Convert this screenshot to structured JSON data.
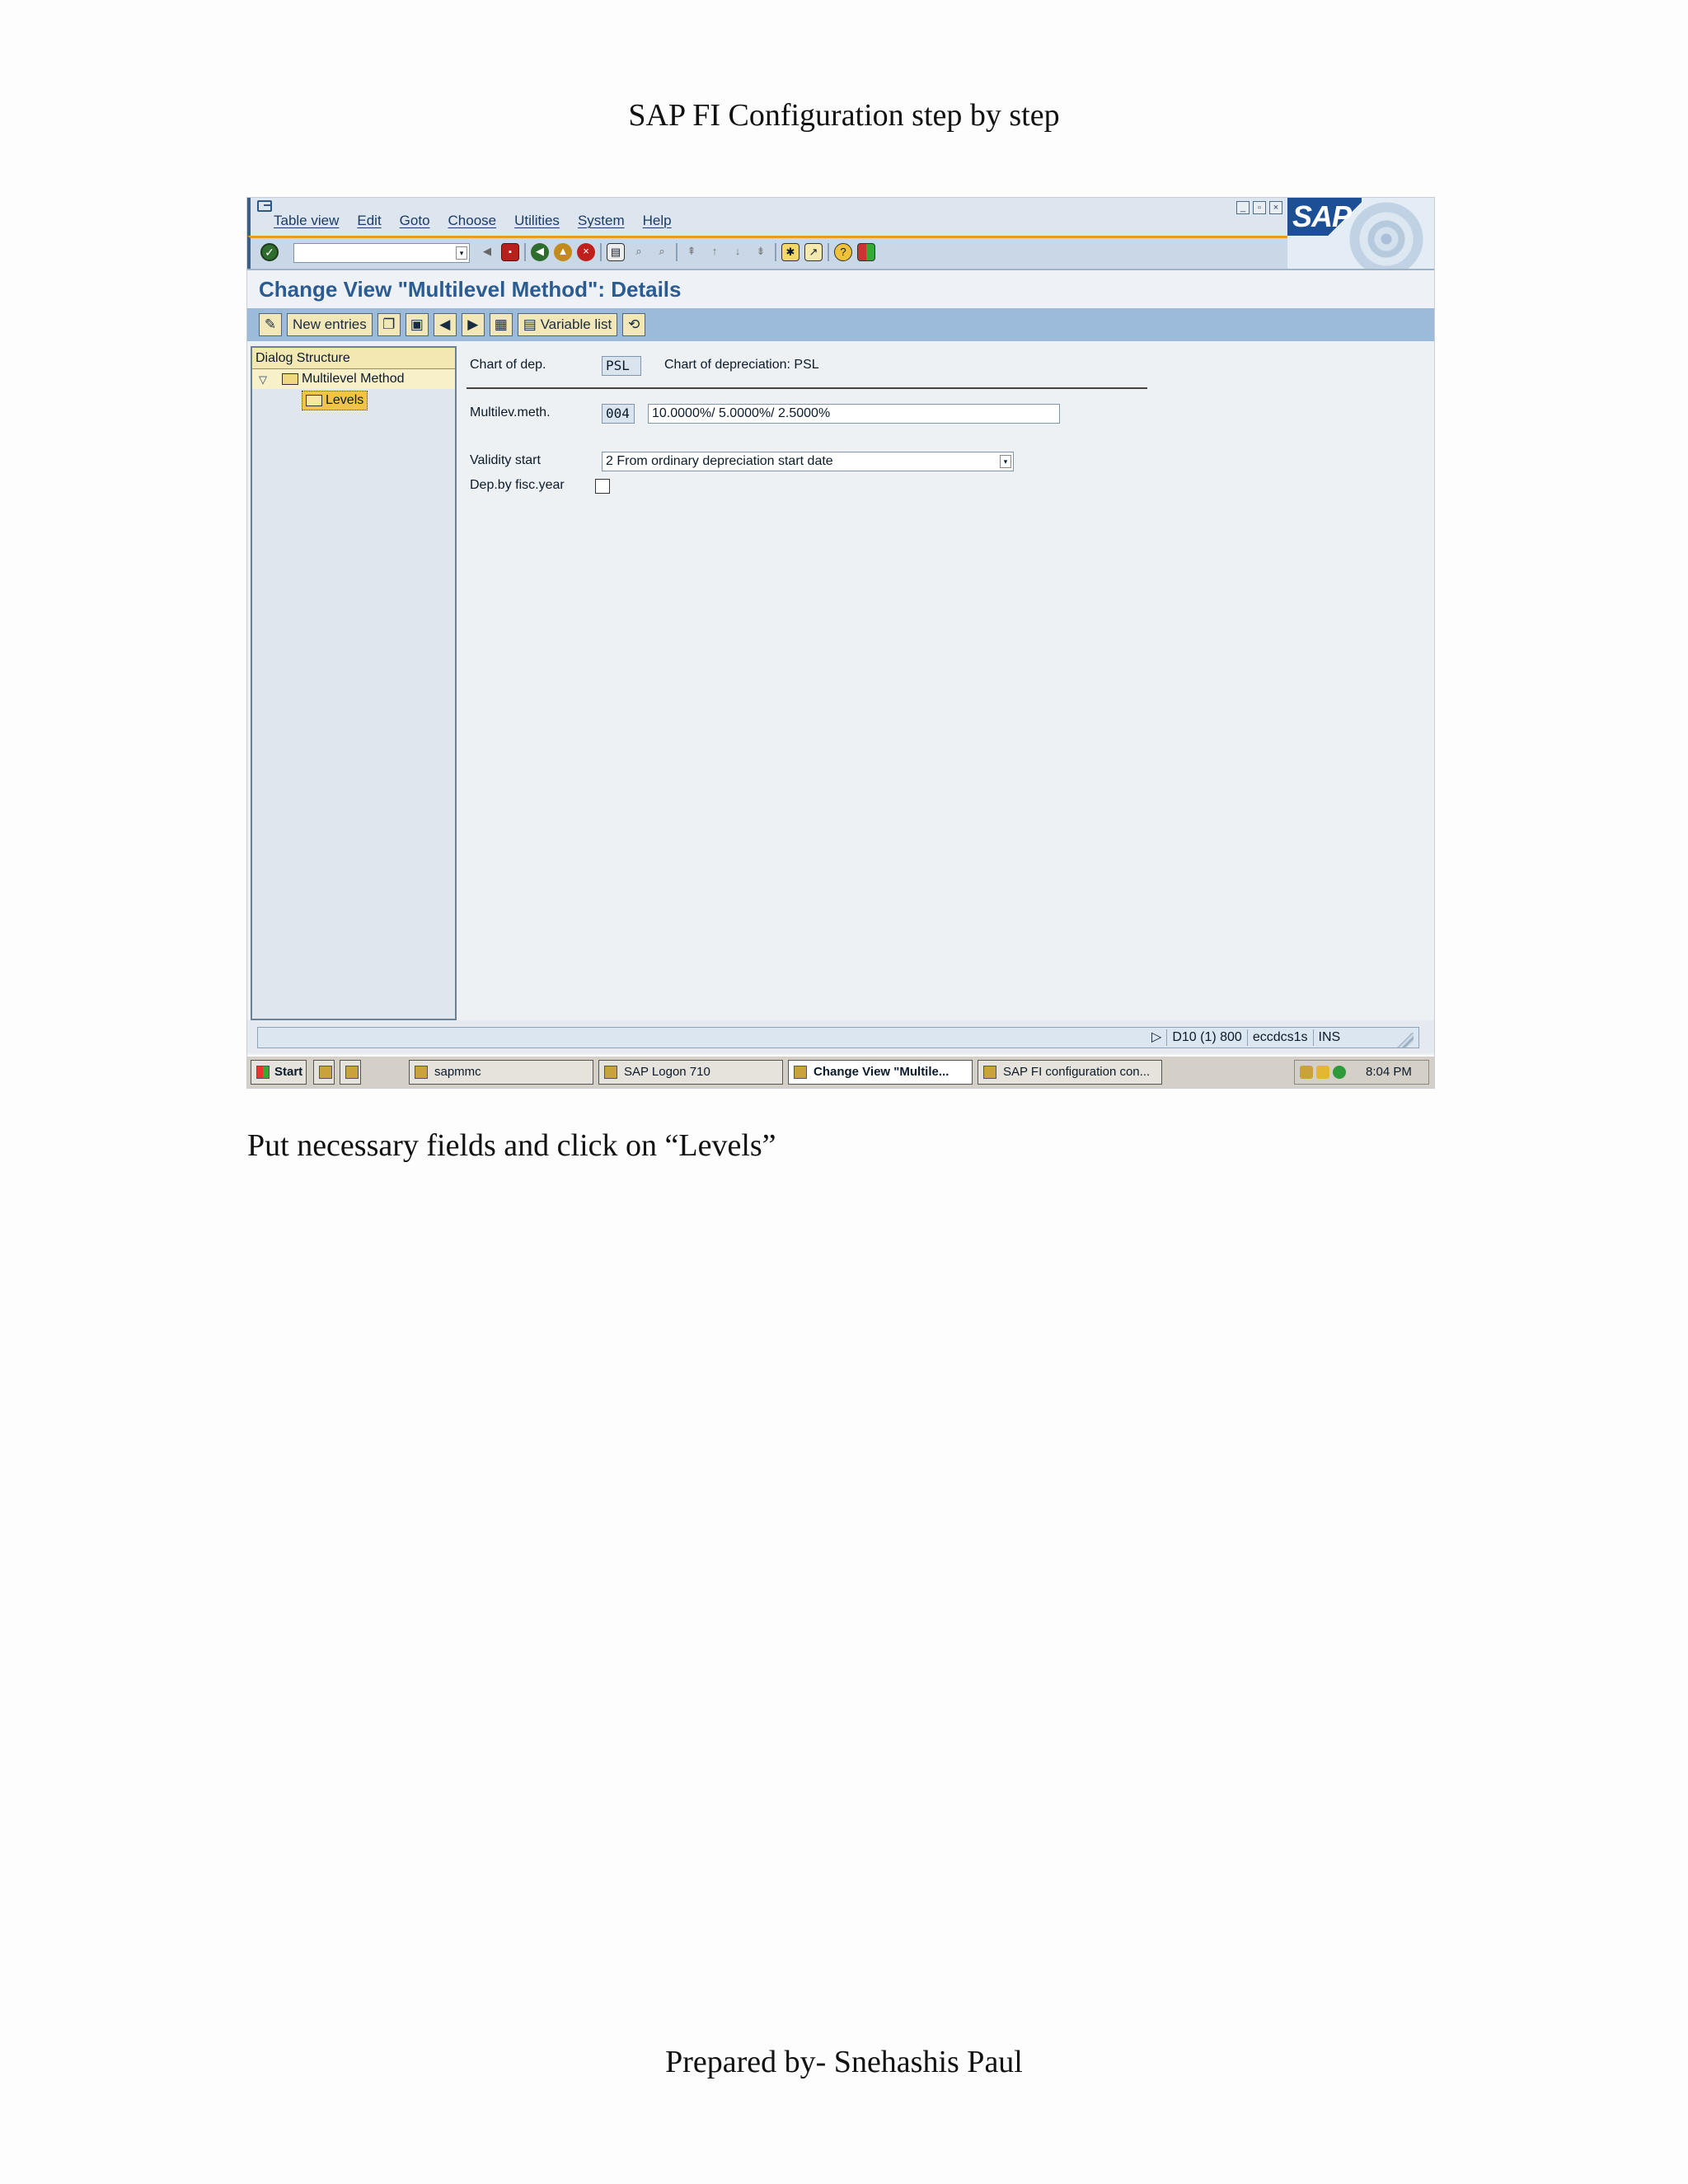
{
  "document": {
    "title": "SAP FI Configuration step by step",
    "caption": "Put necessary fields and click on “Levels”",
    "footer": "Prepared by- Snehashis Paul"
  },
  "sap": {
    "menu": [
      "Table view",
      "Edit",
      "Goto",
      "Choose",
      "Utilities",
      "System",
      "Help"
    ],
    "logo_text": "SAP",
    "page_title": "Change View \"Multilevel Method\": Details",
    "app_toolbar": {
      "new_entries": "New entries",
      "variable_list": "Variable list"
    },
    "dialog_structure": {
      "header": "Dialog Structure",
      "items": [
        "Multilevel Method",
        "Levels"
      ]
    },
    "fields": {
      "chart_of_dep_label": "Chart of dep.",
      "chart_of_dep_value": "PSL",
      "chart_of_dep_desc": "Chart of depreciation: PSL",
      "multilev_meth_label": "Multilev.meth.",
      "multilev_meth_value": "004",
      "multilev_meth_desc": "10.0000%/ 5.0000%/ 2.5000%",
      "validity_start_label": "Validity start",
      "validity_start_value": "2 From ordinary depreciation start date",
      "dep_by_fisc_year_label": "Dep.by fisc.year",
      "dep_by_fisc_year_checked": false
    },
    "status": {
      "system": "D10 (1) 800",
      "server": "eccdcs1s",
      "mode": "INS"
    },
    "taskbar": {
      "start": "Start",
      "items": [
        "sapmmc",
        "SAP Logon 710",
        "Change View \"Multile...",
        "SAP FI configuration con..."
      ],
      "clock": "8:04 PM"
    },
    "colors": {
      "title_blue": "#2a5b92",
      "app_toolbar_blue": "#9cbad9",
      "button_yellow": "#f1e7b8"
    }
  }
}
